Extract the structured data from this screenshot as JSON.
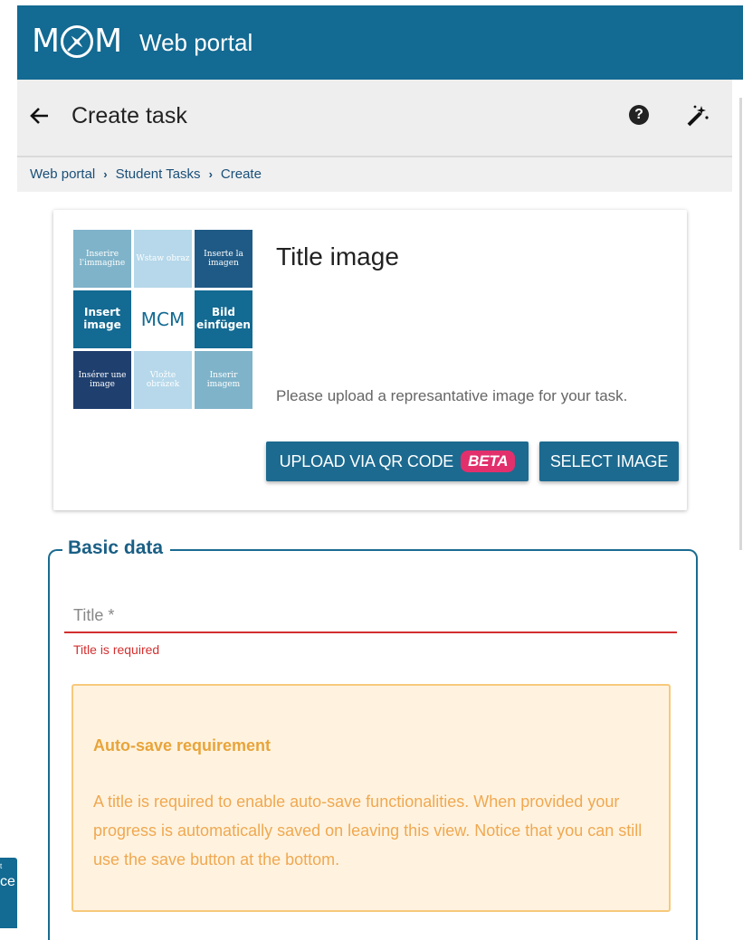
{
  "app": {
    "title": "Web portal",
    "logo_left": "M",
    "logo_right": "M"
  },
  "toolbar": {
    "page_title": "Create task",
    "help_icon": "question-circle-icon",
    "wand_icon": "magic-wand-icon"
  },
  "breadcrumb": [
    "Web portal",
    "Student Tasks",
    "Create"
  ],
  "title_image": {
    "heading": "Title image",
    "hint": "Please upload a represantative image for your task.",
    "upload_qr_label": "UPLOAD VIA QR CODE",
    "beta_badge": "BETA",
    "select_label": "SELECT IMAGE",
    "tiles": [
      {
        "text": "Inserire l'immagine",
        "color": "#7fb3c9",
        "size": "small"
      },
      {
        "text": "Wstaw obraz",
        "color": "#b6d8ea",
        "size": "small"
      },
      {
        "text": "Inserte la imagen",
        "color": "#1f5a86",
        "size": "small"
      },
      {
        "text": "Insert image",
        "color": "#136a92",
        "size": "big"
      },
      {
        "text": "MCM",
        "color": "#ffffff",
        "size": "center"
      },
      {
        "text": "Bild einfügen",
        "color": "#136a92",
        "size": "big"
      },
      {
        "text": "Insérer une image",
        "color": "#1f3f6e",
        "size": "small"
      },
      {
        "text": "Vložte obrázek",
        "color": "#b6d8ea",
        "size": "small"
      },
      {
        "text": "Inserir imagem",
        "color": "#7fb3c9",
        "size": "small"
      }
    ]
  },
  "basic_data": {
    "legend": "Basic data",
    "title_placeholder": "Title *",
    "title_value": "",
    "title_error": "Title is required",
    "warning_title": "Auto-save requirement",
    "warning_body": "A title is required to enable auto-save functionalities. When provided your progress is automatically saved on leaving this view. Notice that you can still use the save button at the bottom."
  },
  "fragment": {
    "text": "ce",
    "small": "t"
  },
  "colors": {
    "primary": "#136a92",
    "error": "#d32f2f",
    "warning_bg": "#fff3e0",
    "warning_text": "#f0a850",
    "beta": "#e2306c"
  }
}
